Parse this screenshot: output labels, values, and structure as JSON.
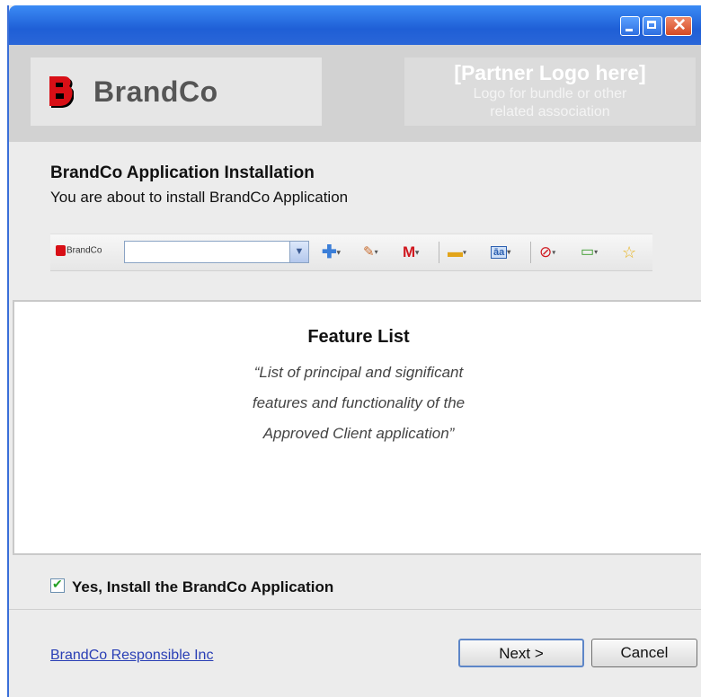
{
  "banner": {
    "brand_name": "BrandCo",
    "partner_title": "[Partner Logo here]",
    "partner_sub_line1": "Logo for bundle or other",
    "partner_sub_line2": "related association"
  },
  "header": {
    "title": "BrandCo Application Installation",
    "subtitle": "You are about to install BrandCo Application"
  },
  "toolbar": {
    "brand_label": "BrandCo",
    "search_value": "",
    "icons": [
      "add-icon",
      "ticket-icon",
      "mail-icon",
      "comment-icon",
      "translate-icon",
      "block-icon",
      "battery-icon",
      "star-icon"
    ]
  },
  "feature": {
    "title": "Feature List",
    "desc_line1": "“List of principal and significant",
    "desc_line2": "features and functionality of the",
    "desc_line3": "Approved Client application”"
  },
  "confirm": {
    "checked": true,
    "label": "Yes, Install the BrandCo Application"
  },
  "footer": {
    "link": "BrandCo Responsible Inc",
    "next_label": "Next >",
    "cancel_label": "Cancel"
  },
  "colors": {
    "titlebar": "#2a66d8",
    "brand_red": "#d80f16",
    "link": "#2a3fb5"
  }
}
